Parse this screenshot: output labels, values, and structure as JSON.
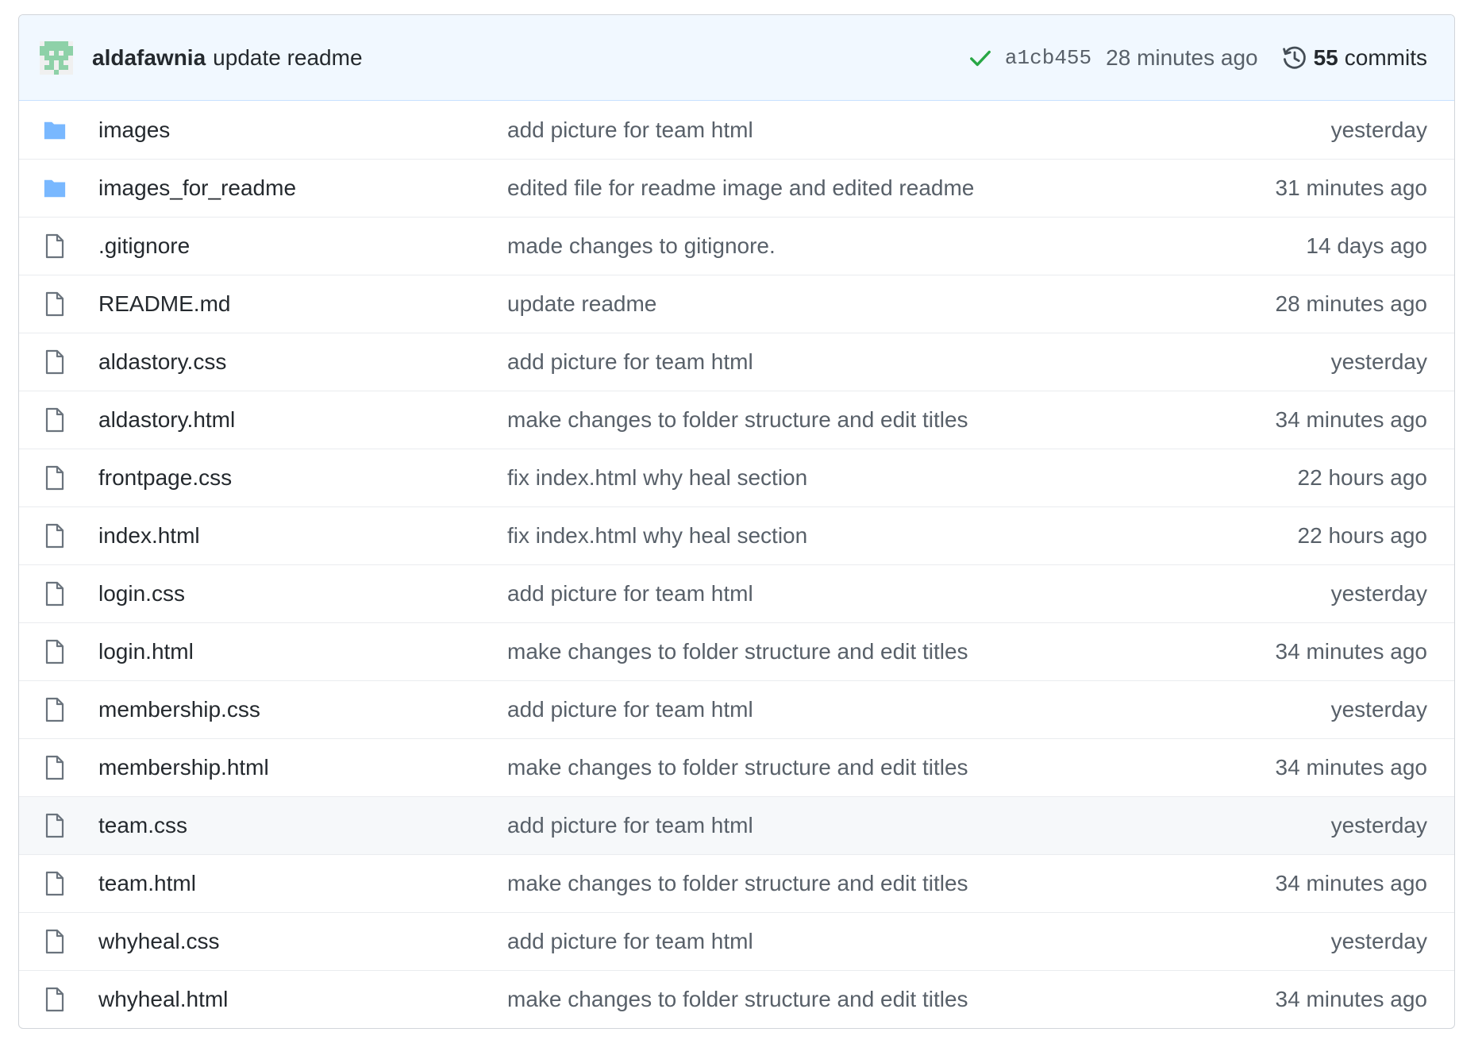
{
  "latest_commit": {
    "author": "aldafawnia",
    "message": "update readme",
    "sha": "a1cb455",
    "time": "28 minutes ago",
    "commits_count": "55",
    "commits_label": "commits",
    "status": "success",
    "status_color": "#28a745"
  },
  "colors": {
    "folder": "#79b8ff",
    "file_icon": "#6a737d",
    "header_bg": "#f1f8ff"
  },
  "files": [
    {
      "name": "images",
      "type": "folder",
      "message": "add picture for team html",
      "age": "yesterday"
    },
    {
      "name": "images_for_readme",
      "type": "folder",
      "message": "edited file for readme image and edited readme",
      "age": "31 minutes ago"
    },
    {
      "name": ".gitignore",
      "type": "file",
      "message": "made changes to gitignore.",
      "age": "14 days ago"
    },
    {
      "name": "README.md",
      "type": "file",
      "message": "update readme",
      "age": "28 minutes ago"
    },
    {
      "name": "aldastory.css",
      "type": "file",
      "message": "add picture for team html",
      "age": "yesterday"
    },
    {
      "name": "aldastory.html",
      "type": "file",
      "message": "make changes to folder structure and edit titles",
      "age": "34 minutes ago"
    },
    {
      "name": "frontpage.css",
      "type": "file",
      "message": "fix index.html why heal section",
      "age": "22 hours ago"
    },
    {
      "name": "index.html",
      "type": "file",
      "message": "fix index.html why heal section",
      "age": "22 hours ago"
    },
    {
      "name": "login.css",
      "type": "file",
      "message": "add picture for team html",
      "age": "yesterday"
    },
    {
      "name": "login.html",
      "type": "file",
      "message": "make changes to folder structure and edit titles",
      "age": "34 minutes ago"
    },
    {
      "name": "membership.css",
      "type": "file",
      "message": "add picture for team html",
      "age": "yesterday"
    },
    {
      "name": "membership.html",
      "type": "file",
      "message": "make changes to folder structure and edit titles",
      "age": "34 minutes ago"
    },
    {
      "name": "team.css",
      "type": "file",
      "message": "add picture for team html",
      "age": "yesterday",
      "hovered": true
    },
    {
      "name": "team.html",
      "type": "file",
      "message": "make changes to folder structure and edit titles",
      "age": "34 minutes ago"
    },
    {
      "name": "whyheal.css",
      "type": "file",
      "message": "add picture for team html",
      "age": "yesterday"
    },
    {
      "name": "whyheal.html",
      "type": "file",
      "message": "make changes to folder structure and edit titles",
      "age": "34 minutes ago"
    }
  ]
}
